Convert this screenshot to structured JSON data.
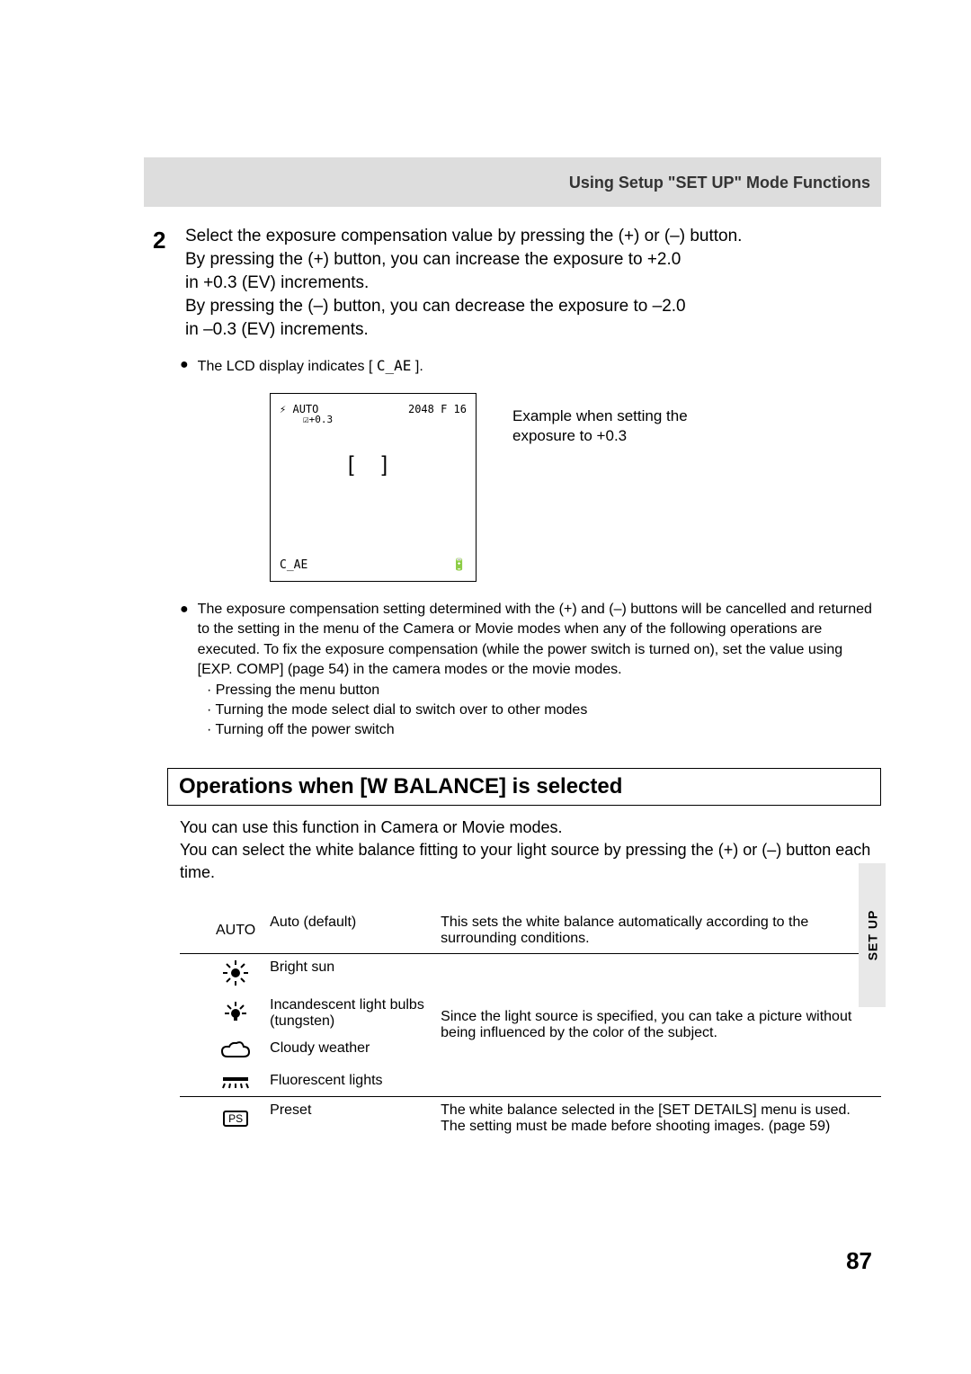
{
  "breadcrumb": "Using Setup \"SET UP\" Mode Functions",
  "step": {
    "num": "2",
    "line1": "Select the exposure compensation value by pressing the (+) or (–) button.",
    "line2": "By pressing the (+) button, you can increase the exposure to +2.0",
    "line3": "in +0.3 (EV) increments.",
    "line4": "By pressing the (–) button, you can decrease the exposure to –2.0",
    "line5": "in –0.3 (EV) increments."
  },
  "lcd_note_prefix": "The LCD display indicates [",
  "lcd_note_symbol": "C_AE",
  "lcd_note_suffix": "].",
  "lcd": {
    "flash": "⚡",
    "auto": "AUTO",
    "res": "2048 F   16",
    "ev_icon": "☑",
    "ev": "+0.3",
    "brackets": "[   ]",
    "mode": "C_AE",
    "battery": "🔋"
  },
  "lcd_caption": "Example when setting the exposure to +0.3",
  "notes": {
    "main": "The exposure compensation setting determined with the (+) and (–) buttons will be cancelled and returned to the setting in the menu of the Camera or Movie modes when any of the following operations are executed. To fix the exposure compensation (while the power switch is turned on), set the value using [EXP. COMP] (page 54) in the camera modes or the movie modes.",
    "sub1": "· Pressing the menu button",
    "sub2": "· Turning the mode select dial to switch over to other modes",
    "sub3": "· Turning off the power switch"
  },
  "section": {
    "heading": "Operations when [W BALANCE] is selected",
    "p1": "You can use this function in Camera or Movie modes.",
    "p2": "You can select the white balance fitting to your light source by pressing the (+) or (–) button each time."
  },
  "wb": {
    "rows": [
      {
        "icon": "AUTO",
        "label": "Auto (default)",
        "desc": "This sets the white balance automatically according to the surrounding conditions."
      },
      {
        "icon": "sun",
        "label": "Bright sun"
      },
      {
        "icon": "bulb",
        "label": "Incandescent light bulbs (tungsten)"
      },
      {
        "icon": "cloud",
        "label": "Cloudy weather"
      },
      {
        "icon": "fluor",
        "label": "Fluorescent lights"
      },
      {
        "icon": "PS",
        "label": "Preset",
        "desc": "The white balance selected in the [SET DETAILS] menu is used. The setting must be made before shooting images. (page 59)"
      }
    ],
    "group_desc": "Since the light source is specified, you can take a picture without being influenced by the color of the subject."
  },
  "sidebar": "SET UP",
  "page_number": "87"
}
